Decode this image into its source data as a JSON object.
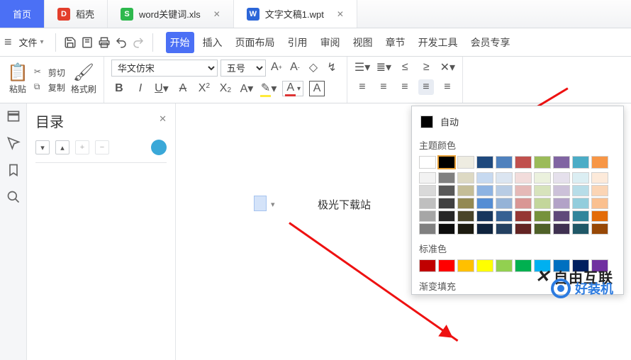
{
  "tabs": {
    "home": "首页",
    "t1": {
      "label": "稻壳"
    },
    "t2": {
      "label": "word关键词.xls"
    },
    "t3": {
      "label": "文字文稿1.wpt"
    }
  },
  "menubar": {
    "file": "文件",
    "items": [
      "开始",
      "插入",
      "页面布局",
      "引用",
      "审阅",
      "视图",
      "章节",
      "开发工具",
      "会员专享"
    ]
  },
  "clipboard": {
    "paste": "粘贴",
    "cut": "剪切",
    "copy": "复制",
    "format": "格式刷"
  },
  "font": {
    "family": "华文仿宋",
    "size": "五号"
  },
  "toc": {
    "title": "目录"
  },
  "doc": {
    "text": "极光下载站"
  },
  "colorpanel": {
    "auto": "自动",
    "theme_label": "主题颜色",
    "standard_label": "标准色",
    "gradient_label": "渐变填充",
    "theme": [
      "#ffffff",
      "#000000",
      "#eeece1",
      "#1f497d",
      "#4f81bd",
      "#c0504d",
      "#9bbb59",
      "#8064a2",
      "#4bacc6",
      "#f79646"
    ],
    "shades": [
      [
        "#f2f2f2",
        "#808080",
        "#ddd9c3",
        "#c6d9f0",
        "#dbe5f1",
        "#f2dcdb",
        "#ebf1dd",
        "#e5e0ec",
        "#dbeef3",
        "#fdeada"
      ],
      [
        "#d9d9d9",
        "#595959",
        "#c4bd97",
        "#8db3e2",
        "#b8cce4",
        "#e5b9b7",
        "#d7e3bc",
        "#ccc1d9",
        "#b7dde8",
        "#fbd5b5"
      ],
      [
        "#bfbfbf",
        "#404040",
        "#938953",
        "#548dd4",
        "#95b3d7",
        "#d99694",
        "#c3d69b",
        "#b2a2c7",
        "#92cddc",
        "#fac08f"
      ],
      [
        "#a6a6a6",
        "#262626",
        "#494429",
        "#17365d",
        "#366092",
        "#953734",
        "#76923c",
        "#5f497a",
        "#31859b",
        "#e36c09"
      ],
      [
        "#808080",
        "#0d0d0d",
        "#1d1b10",
        "#0f243e",
        "#244061",
        "#632423",
        "#4f6128",
        "#3f3151",
        "#205867",
        "#974806"
      ]
    ],
    "standard": [
      "#c00000",
      "#ff0000",
      "#ffc000",
      "#ffff00",
      "#92d050",
      "#00b050",
      "#00b0f0",
      "#0070c0",
      "#002060",
      "#7030a0"
    ]
  },
  "watermark": {
    "a": "自由互联",
    "b": "好装机"
  }
}
